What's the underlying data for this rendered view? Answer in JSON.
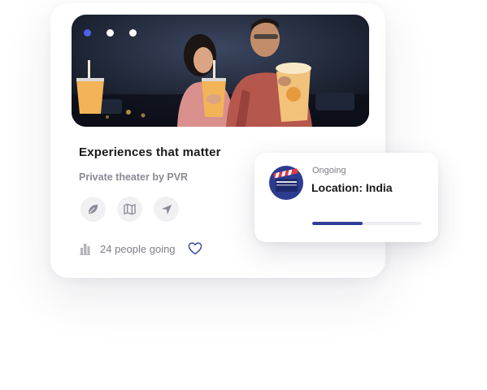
{
  "card": {
    "title": "Experiences that matter",
    "subtitle": "Private theater by PVR",
    "carousel": {
      "total": 3,
      "active": 0
    },
    "actions": [
      {
        "icon": "leaf-icon"
      },
      {
        "icon": "map-icon"
      },
      {
        "icon": "navigation-icon"
      }
    ],
    "attendees_text": "24 people going",
    "favorite": false
  },
  "status": {
    "badge": "Ongoing",
    "location": "Location: India",
    "progress": 0.46
  },
  "colors": {
    "accent_dot": "#4a63e6",
    "progress_fill": "#2f3f9a",
    "icon_bg": "#f1f1f4",
    "heart": "#3a4aa0",
    "clapper_circle": "#2c3c8f",
    "clapper_stripe": "#e2384a"
  }
}
